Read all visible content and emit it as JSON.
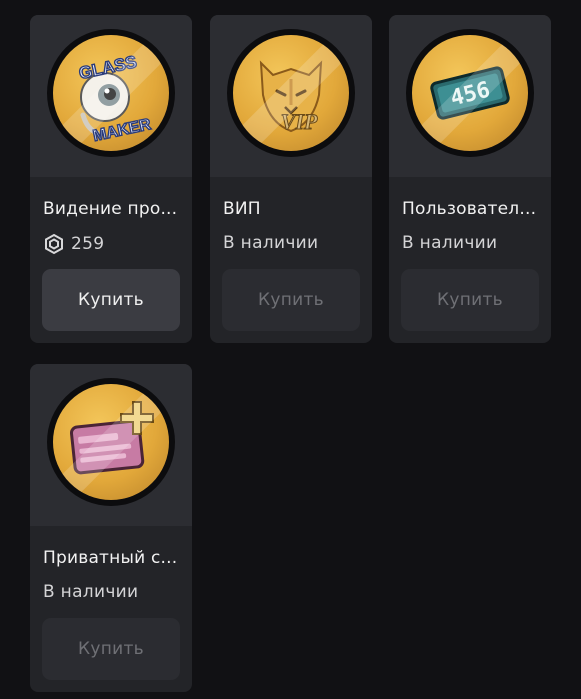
{
  "items": [
    {
      "title": "Видение про...",
      "price": "259",
      "icon": "glass-maker-eye-icon",
      "badge_text": [
        "GLASS",
        "MAKER"
      ],
      "buy_label": "Купить",
      "buy_enabled": true
    },
    {
      "title": "ВИП",
      "status": "В наличии",
      "icon": "vip-lion-icon",
      "badge_text": [
        "VIP"
      ],
      "buy_label": "Купить",
      "buy_enabled": false
    },
    {
      "title": "Пользовател...",
      "status": "В наличии",
      "icon": "number-tag-icon",
      "badge_text": [
        "456"
      ],
      "buy_label": "Купить",
      "buy_enabled": false
    },
    {
      "title": "Приватный с...",
      "status": "В наличии",
      "icon": "private-card-plus-icon",
      "buy_label": "Купить",
      "buy_enabled": false
    }
  ],
  "colors": {
    "background": "#111114",
    "card": "#232428",
    "thumb": "#2c2d32",
    "badge_gold": "#e2a83a",
    "active_button": "#3b3c42",
    "disabled_button": "#2b2c31"
  }
}
